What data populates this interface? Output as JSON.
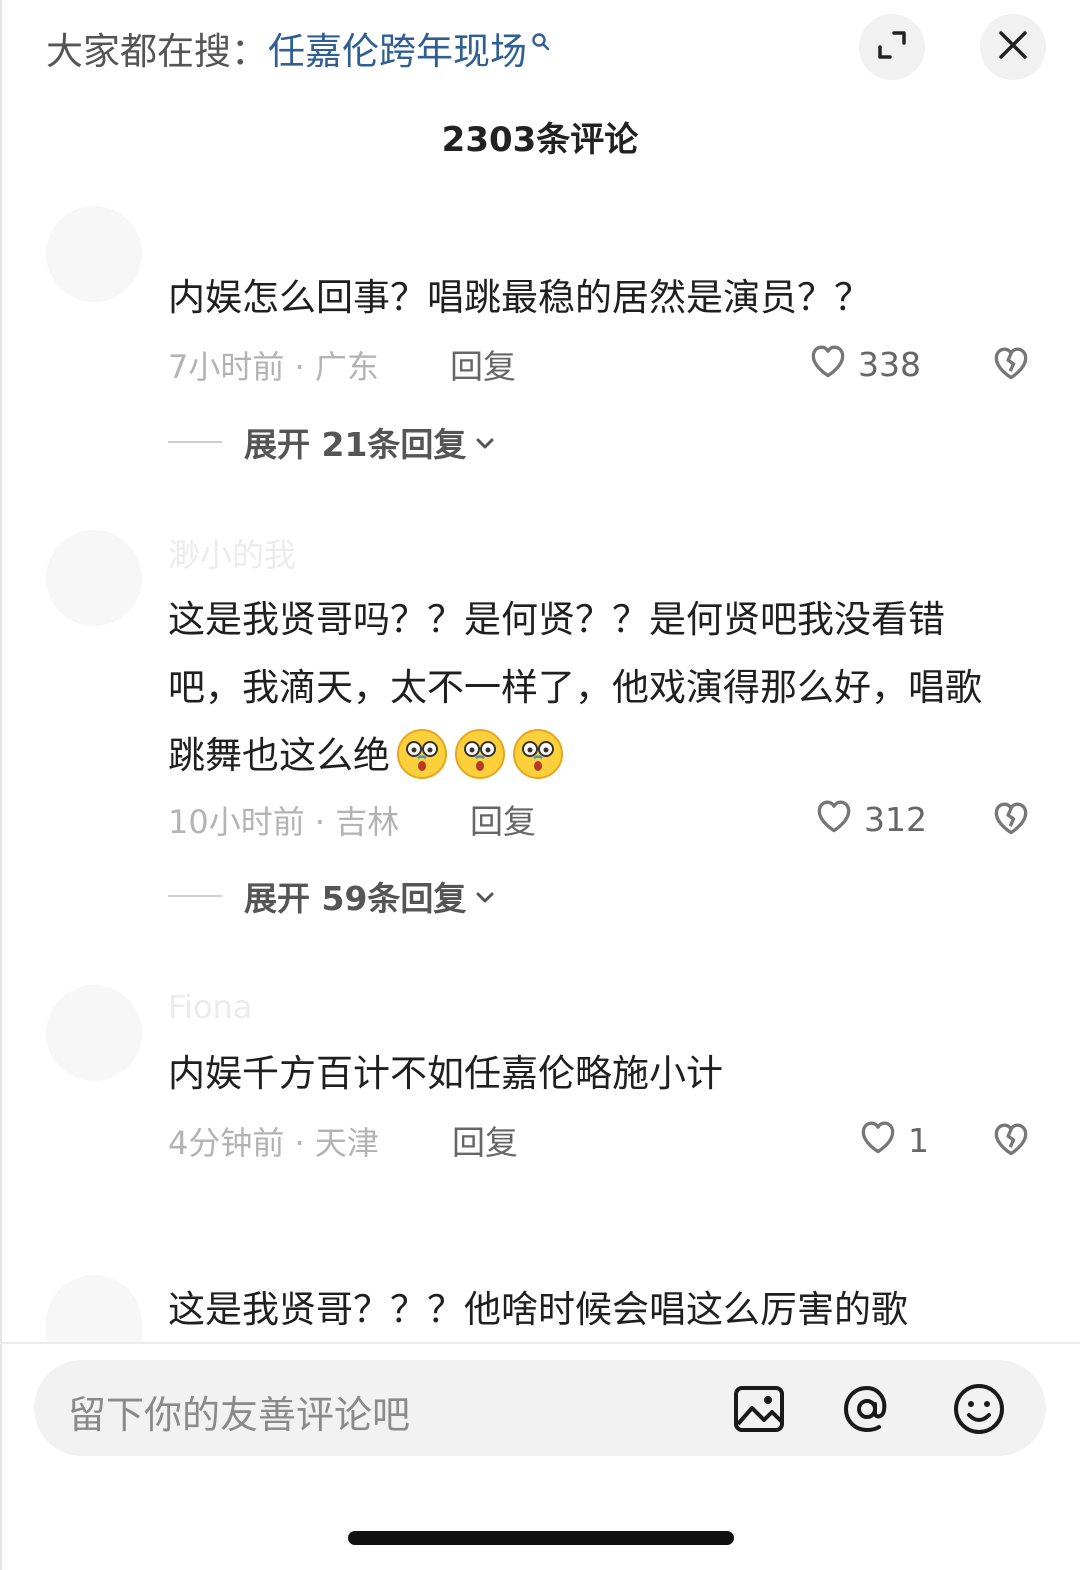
{
  "header": {
    "search_prefix": "大家都在搜：",
    "search_term": "任嘉伦跨年现场",
    "comment_count": "2303条评论"
  },
  "comments": [
    {
      "username": "",
      "text": "内娱怎么回事？唱跳最稳的居然是演员？？",
      "meta": "7小时前 · 广东",
      "reply_label": "回复",
      "likes": "338",
      "expand_label": "展开 21条回复"
    },
    {
      "username": "渺小的我",
      "text": "这是我贤哥吗？？是何贤？？是何贤吧我没看错吧，我滴天，太不一样了，他戏演得那么好，唱歌跳舞也这么绝",
      "meta": "10小时前 · 吉林",
      "reply_label": "回复",
      "likes": "312",
      "expand_label": "展开 59条回复"
    },
    {
      "username": "Fiona",
      "text": "内娱千方百计不如任嘉伦略施小计",
      "meta": "4分钟前 · 天津",
      "reply_label": "回复",
      "likes": "1"
    },
    {
      "text": "这是我贤哥？？？他啥时候会唱这么厉害的歌"
    }
  ],
  "input": {
    "placeholder": "留下你的友善评论吧"
  },
  "icons": [
    "search-icon",
    "expand-icon",
    "close-icon",
    "heart-icon",
    "broken-heart-icon",
    "chevron-down-icon",
    "image-icon",
    "at-icon",
    "smiley-icon",
    "astonished-emoji-icon"
  ]
}
